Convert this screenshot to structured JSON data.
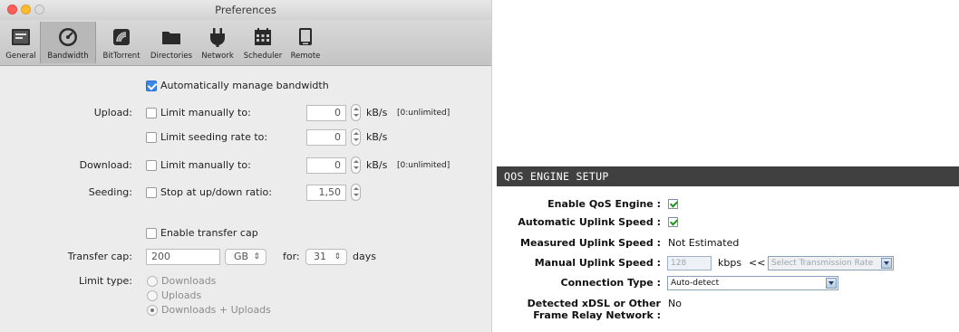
{
  "window": {
    "title": "Preferences"
  },
  "toolbar": [
    {
      "label": "General",
      "icon": "general-icon"
    },
    {
      "label": "Bandwidth",
      "icon": "speedometer-icon"
    },
    {
      "label": "BitTorrent",
      "icon": "bittorrent-icon"
    },
    {
      "label": "Directories",
      "icon": "folder-icon"
    },
    {
      "label": "Network",
      "icon": "plug-icon"
    },
    {
      "label": "Scheduler",
      "icon": "calendar-icon"
    },
    {
      "label": "Remote",
      "icon": "remote-icon"
    }
  ],
  "bandwidth": {
    "auto_manage": "Automatically manage bandwidth",
    "upload_label": "Upload:",
    "upload_limit": "Limit manually to:",
    "upload_value": "0",
    "seeding_limit": "Limit seeding rate to:",
    "seeding_value": "0",
    "download_label": "Download:",
    "download_limit": "Limit manually to:",
    "download_value": "0",
    "seeding_label": "Seeding:",
    "ratio_text": "Stop at up/down ratio:",
    "ratio_value": "1,50",
    "unit": "kB/s",
    "unlimited_hint": "[0:unlimited]",
    "enable_cap": "Enable transfer cap",
    "cap_label": "Transfer cap:",
    "cap_value": "200",
    "cap_unit": "GB",
    "for_label": "for:",
    "days_value": "31",
    "days_label": "days",
    "limit_type_label": "Limit type:",
    "limit_types": [
      "Downloads",
      "Uploads",
      "Downloads + Uploads"
    ]
  },
  "qos": {
    "header": "QOS ENGINE SETUP",
    "enable_label": "Enable QoS Engine :",
    "auto_uplink_label": "Automatic Uplink Speed :",
    "measured_label": "Measured Uplink Speed :",
    "measured_value": "Not Estimated",
    "manual_label": "Manual Uplink Speed :",
    "manual_value": "128",
    "kbps": "kbps",
    "arrows": "<<",
    "rate_select": "Select Transmission Rate",
    "conn_label": "Connection Type :",
    "conn_value": "Auto-detect",
    "xdsl_label_1": "Detected xDSL or Other",
    "xdsl_label_2": "Frame Relay Network :",
    "xdsl_value": "No"
  }
}
